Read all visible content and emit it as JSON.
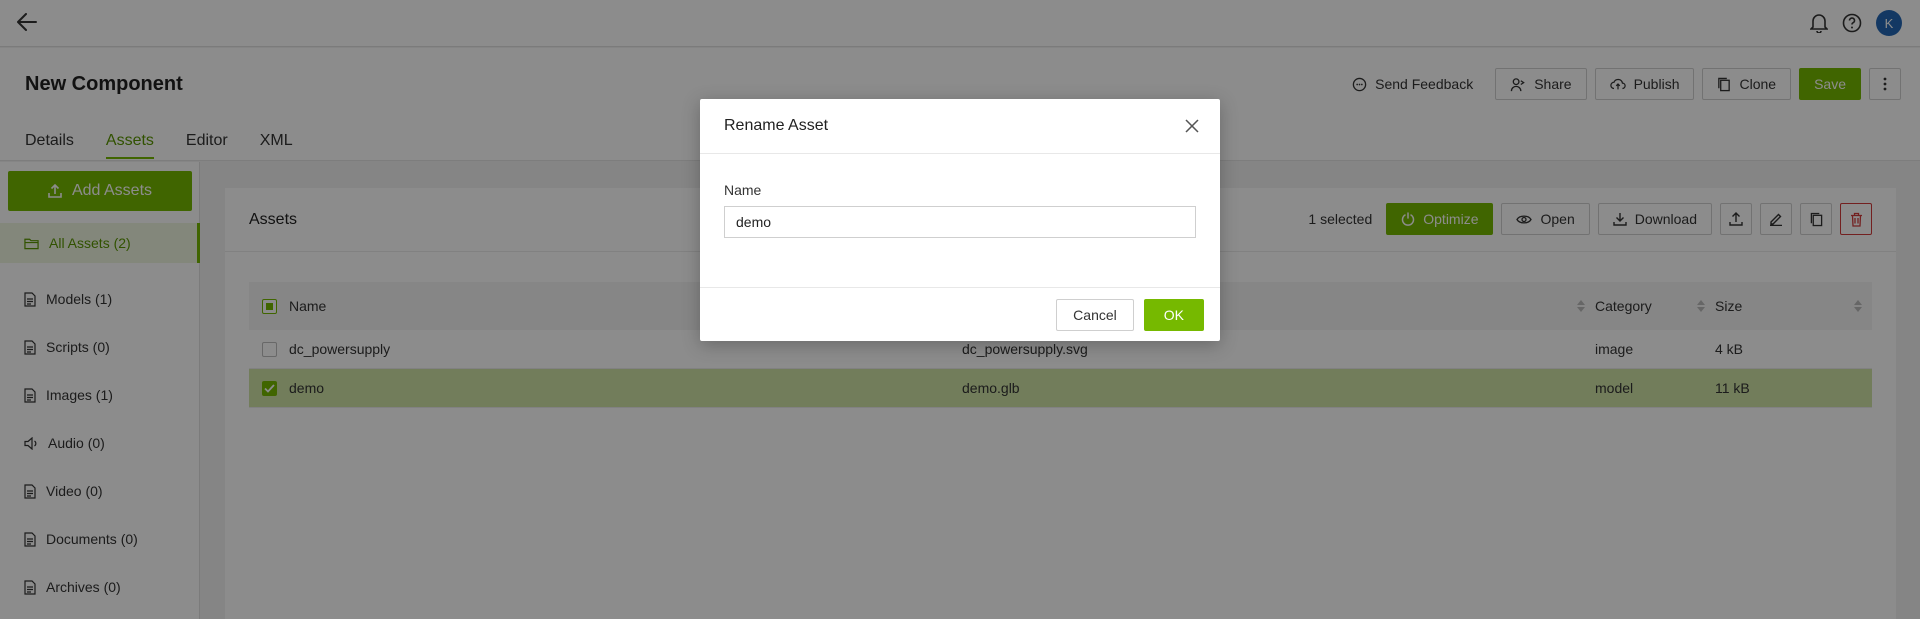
{
  "topbar": {
    "avatar_initial": "K"
  },
  "header": {
    "title": "New Component",
    "actions": {
      "send_feedback": "Send Feedback",
      "share": "Share",
      "publish": "Publish",
      "clone": "Clone",
      "save": "Save"
    },
    "tabs": [
      "Details",
      "Assets",
      "Editor",
      "XML"
    ],
    "active_tab": "Assets"
  },
  "sidebar": {
    "add_button": "Add Assets",
    "items": [
      {
        "label": "All Assets (2)",
        "icon": "folder-icon"
      },
      {
        "label": "Models (1)",
        "icon": "document-icon"
      },
      {
        "label": "Scripts (0)",
        "icon": "document-icon"
      },
      {
        "label": "Images (1)",
        "icon": "document-icon"
      },
      {
        "label": "Audio (0)",
        "icon": "speaker-icon"
      },
      {
        "label": "Video (0)",
        "icon": "document-icon"
      },
      {
        "label": "Documents (0)",
        "icon": "document-icon"
      },
      {
        "label": "Archives (0)",
        "icon": "document-icon"
      }
    ]
  },
  "main": {
    "title": "Assets",
    "selected_count": "1 selected",
    "toolbar": {
      "optimize": "Optimize",
      "open": "Open",
      "download": "Download"
    },
    "table": {
      "headers": {
        "name": "Name",
        "category": "Category",
        "size": "Size"
      },
      "rows": [
        {
          "name": "dc_powersupply",
          "file": "dc_powersupply.svg",
          "category": "image",
          "size": "4 kB",
          "selected": false
        },
        {
          "name": "demo",
          "file": "demo.glb",
          "category": "model",
          "size": "11 kB",
          "selected": true
        }
      ]
    }
  },
  "modal": {
    "title": "Rename Asset",
    "field_label": "Name",
    "field_value": "demo",
    "cancel": "Cancel",
    "ok": "OK"
  },
  "colors": {
    "accent": "#76b900",
    "danger": "#d23b3b",
    "avatar": "#2467b4"
  }
}
